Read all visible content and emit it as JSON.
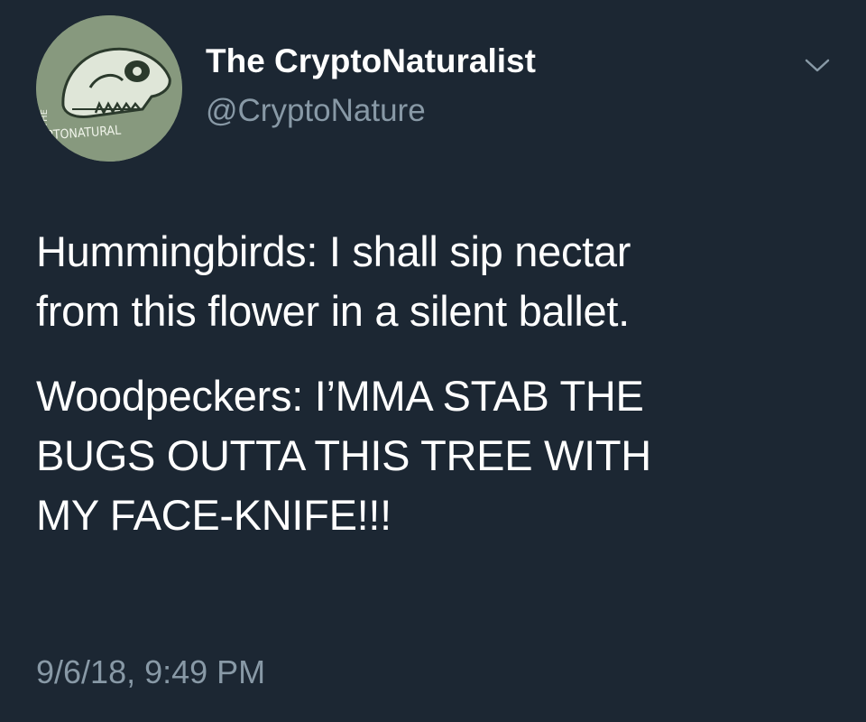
{
  "user": {
    "display_name": "The CryptoNaturalist",
    "handle": "@CryptoNature",
    "avatar_text": "THE CRYPTONATURALIST"
  },
  "tweet": {
    "paragraphs": [
      "Hummingbirds: I shall sip nectar\nfrom this flower in a silent ballet.",
      "Woodpeckers: I’MMA STAB THE\nBUGS OUTTA THIS TREE WITH\nMY FACE-KNIFE!!!"
    ],
    "timestamp": "9/6/18, 9:49 PM"
  },
  "icons": {
    "menu": "chevron-down-icon",
    "avatar": "skull-avatar"
  },
  "colors": {
    "background": "#1c2733",
    "primary_text": "#ffffff",
    "secondary_text": "#8899a6",
    "avatar_bg": "#87997e"
  }
}
